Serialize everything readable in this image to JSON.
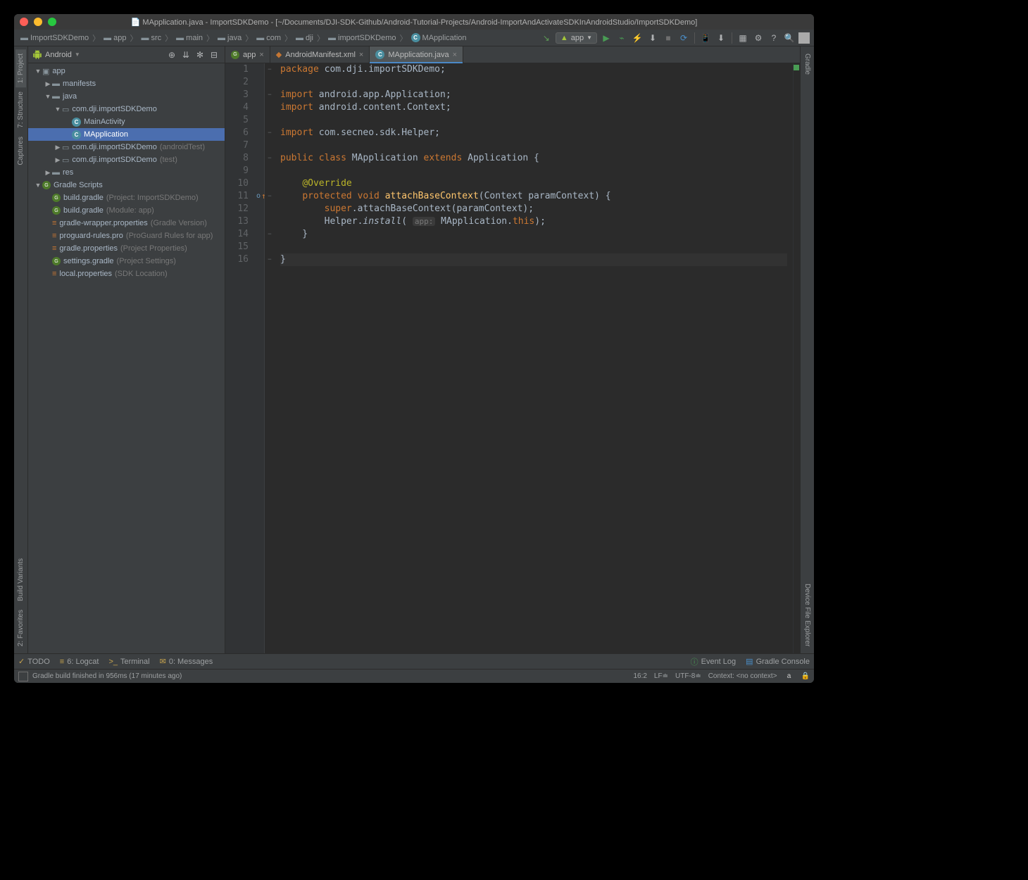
{
  "window_title": "MApplication.java - ImportSDKDemo - [~/Documents/DJI-SDK-Github/Android-Tutorial-Projects/Android-ImportAndActivateSDKInAndroidStudio/ImportSDKDemo]",
  "breadcrumbs": [
    "ImportSDKDemo",
    "app",
    "src",
    "main",
    "java",
    "com",
    "dji",
    "importSDKDemo",
    "MApplication"
  ],
  "run_config": "app",
  "sidebar": {
    "title": "Android",
    "tree": [
      {
        "indent": 0,
        "arrow": "▼",
        "icon": "module",
        "label": "app"
      },
      {
        "indent": 1,
        "arrow": "▶",
        "icon": "folder",
        "label": "manifests"
      },
      {
        "indent": 1,
        "arrow": "▼",
        "icon": "folder",
        "label": "java"
      },
      {
        "indent": 2,
        "arrow": "▼",
        "icon": "package",
        "label": "com.dji.importSDKDemo"
      },
      {
        "indent": 3,
        "arrow": "",
        "icon": "class",
        "label": "MainActivity"
      },
      {
        "indent": 3,
        "arrow": "",
        "icon": "class",
        "label": "MApplication",
        "selected": true
      },
      {
        "indent": 2,
        "arrow": "▶",
        "icon": "package",
        "label": "com.dji.importSDKDemo",
        "hint": "(androidTest)"
      },
      {
        "indent": 2,
        "arrow": "▶",
        "icon": "package",
        "label": "com.dji.importSDKDemo",
        "hint": "(test)"
      },
      {
        "indent": 1,
        "arrow": "▶",
        "icon": "folder",
        "label": "res"
      },
      {
        "indent": 0,
        "arrow": "▼",
        "icon": "gradle-root",
        "label": "Gradle Scripts"
      },
      {
        "indent": 1,
        "arrow": "",
        "icon": "gradle",
        "label": "build.gradle",
        "hint": "(Project: ImportSDKDemo)"
      },
      {
        "indent": 1,
        "arrow": "",
        "icon": "gradle",
        "label": "build.gradle",
        "hint": "(Module: app)"
      },
      {
        "indent": 1,
        "arrow": "",
        "icon": "prop",
        "label": "gradle-wrapper.properties",
        "hint": "(Gradle Version)"
      },
      {
        "indent": 1,
        "arrow": "",
        "icon": "prop",
        "label": "proguard-rules.pro",
        "hint": "(ProGuard Rules for app)"
      },
      {
        "indent": 1,
        "arrow": "",
        "icon": "prop",
        "label": "gradle.properties",
        "hint": "(Project Properties)"
      },
      {
        "indent": 1,
        "arrow": "",
        "icon": "gradle",
        "label": "settings.gradle",
        "hint": "(Project Settings)"
      },
      {
        "indent": 1,
        "arrow": "",
        "icon": "prop",
        "label": "local.properties",
        "hint": "(SDK Location)"
      }
    ]
  },
  "tabs": [
    {
      "icon": "gradle",
      "label": "app",
      "active": false
    },
    {
      "icon": "xml",
      "label": "AndroidManifest.xml",
      "active": false
    },
    {
      "icon": "class",
      "label": "MApplication.java",
      "active": true
    }
  ],
  "left_tool_tabs": {
    "top": [
      "1: Project",
      "7: Structure",
      "Captures"
    ],
    "bottom": [
      "Build Variants",
      "2: Favorites"
    ]
  },
  "right_tool_tabs": {
    "top": [
      "Gradle"
    ],
    "bottom": [
      "Device File Explorer"
    ]
  },
  "code": {
    "lines": 16,
    "tokens": [
      [
        [
          "kw",
          "package "
        ],
        [
          "cls",
          "com.dji.importSDKDemo"
        ],
        [
          "p",
          ";"
        ]
      ],
      [],
      [
        [
          "kw",
          "import "
        ],
        [
          "cls",
          "android.app.Application"
        ],
        [
          "p",
          ";"
        ]
      ],
      [
        [
          "kw",
          "import "
        ],
        [
          "cls",
          "android.content.Context"
        ],
        [
          "p",
          ";"
        ]
      ],
      [],
      [
        [
          "kw",
          "import "
        ],
        [
          "cls",
          "com.secneo.sdk.Helper"
        ],
        [
          "p",
          ";"
        ]
      ],
      [],
      [
        [
          "kw",
          "public class "
        ],
        [
          "cls",
          "MApplication "
        ],
        [
          "kw",
          "extends "
        ],
        [
          "cls",
          "Application "
        ],
        [
          "p",
          "{"
        ]
      ],
      [],
      [
        [
          "p",
          "    "
        ],
        [
          "ann",
          "@Override"
        ]
      ],
      [
        [
          "p",
          "    "
        ],
        [
          "kw",
          "protected void "
        ],
        [
          "fn",
          "attachBaseContext"
        ],
        [
          "p",
          "(Context paramContext) {"
        ]
      ],
      [
        [
          "p",
          "        "
        ],
        [
          "kw",
          "super"
        ],
        [
          "p",
          "."
        ],
        [
          "cls",
          "attachBaseContext"
        ],
        [
          "p",
          "(paramContext);"
        ]
      ],
      [
        [
          "p",
          "        Helper."
        ],
        [
          "italic",
          "install"
        ],
        [
          "p",
          "( "
        ],
        [
          "hint",
          "app:"
        ],
        [
          "p",
          " MApplication."
        ],
        [
          "kw",
          "this"
        ],
        [
          "p",
          ");"
        ]
      ],
      [
        [
          "p",
          "    }"
        ]
      ],
      [],
      [
        [
          "p",
          "}"
        ]
      ]
    ]
  },
  "bottom_tabs_left": [
    "TODO",
    "6: Logcat",
    "Terminal",
    "0: Messages"
  ],
  "bottom_tabs_right": [
    "Event Log",
    "Gradle Console"
  ],
  "status": {
    "message": "Gradle build finished in 956ms (17 minutes ago)",
    "line_col": "16:2",
    "line_sep": "LF≐",
    "encoding": "UTF-8≐",
    "context": "Context: <no context>"
  }
}
